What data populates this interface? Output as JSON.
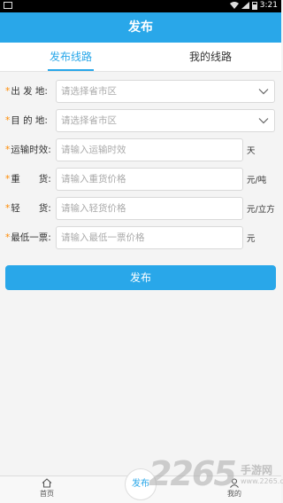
{
  "status_bar": {
    "time": "3:21"
  },
  "header": {
    "title": "发布"
  },
  "tabs": [
    {
      "label": "发布线路",
      "active": true
    },
    {
      "label": "我的线路",
      "active": false
    }
  ],
  "form": {
    "origin": {
      "label": "出 发 地:",
      "placeholder": "请选择省市区"
    },
    "destination": {
      "label": "目 的 地:",
      "placeholder": "请选择省市区"
    },
    "transit_time": {
      "label": "运输时效:",
      "placeholder": "请输入运输时效",
      "unit": "天"
    },
    "heavy_cargo": {
      "label": "重　　货:",
      "placeholder": "请输入重货价格",
      "unit": "元/吨"
    },
    "light_cargo": {
      "label": "轻　　货:",
      "placeholder": "请输入轻货价格",
      "unit": "元/立方"
    },
    "min_ticket": {
      "label": "最低一票:",
      "placeholder": "请输入最低一票价格",
      "unit": "元"
    }
  },
  "submit": {
    "label": "发布"
  },
  "bottom_nav": {
    "home": "首页",
    "publish": "发布",
    "mine": "我的"
  },
  "watermark": {
    "number": "2265",
    "text": "手游网",
    "url": "www.2265.com"
  },
  "colors": {
    "primary": "#29a7e9",
    "required_star": "#ff8a00"
  }
}
